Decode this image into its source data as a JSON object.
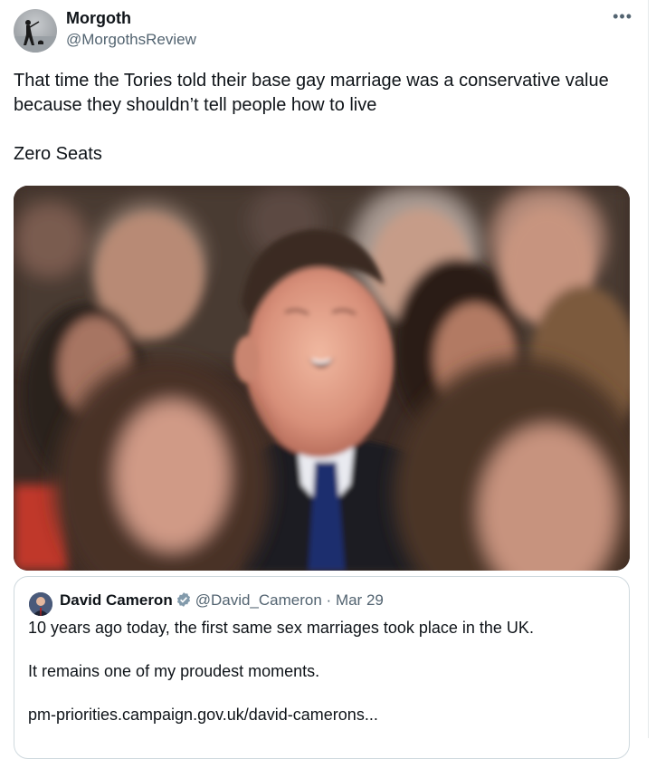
{
  "author": {
    "name": "Morgoth",
    "handle": "@MorgothsReview"
  },
  "tweet": {
    "text": "That time the Tories told their base gay marriage was a conservative value because they shouldn’t tell people how to live\n\nZero Seats"
  },
  "media": {
    "icon": "photo-laughing-crowd"
  },
  "quote": {
    "name": "David Cameron",
    "handle": "@David_Cameron",
    "separator": "·",
    "date": "Mar 29",
    "text": "10 years ago today, the first same sex marriages took place in the UK.\n\nIt remains one of my proudest moments.\n\npm-priorities.campaign.gov.uk/david-camerons..."
  },
  "icons": {
    "more": "ellipsis-icon",
    "verified": "verified-badge-icon"
  },
  "colors": {
    "secondary_text": "#536471",
    "border": "#cfd9de",
    "verified": "#829aab"
  }
}
